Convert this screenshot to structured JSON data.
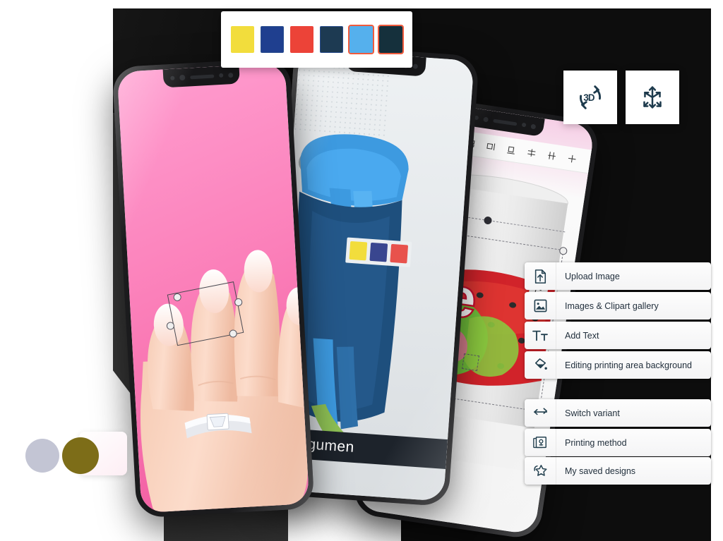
{
  "palette": {
    "name": "color-swatch-bar",
    "swatches": [
      {
        "name": "swatch-yellow",
        "color": "#f2dd3c",
        "selected": false,
        "border": false
      },
      {
        "name": "swatch-royal-blue",
        "color": "#1f3f8f",
        "selected": false,
        "border": true
      },
      {
        "name": "swatch-red",
        "color": "#ec4338",
        "selected": false,
        "border": false
      },
      {
        "name": "swatch-navy",
        "color": "#1d3a52",
        "selected": false,
        "border": true
      },
      {
        "name": "swatch-light-blue",
        "color": "#55b0ed",
        "selected": true,
        "border": false
      },
      {
        "name": "swatch-dark-teal",
        "color": "#15303c",
        "selected": true,
        "border": false
      }
    ]
  },
  "tools": {
    "rotate3d": {
      "label": "3D",
      "name": "rotate-3d-button"
    },
    "move": {
      "label": "",
      "name": "move-transform-button"
    }
  },
  "menu": {
    "group_one": [
      {
        "label": "Upload Image",
        "icon": "upload-image-icon"
      },
      {
        "label": "Images & Clipart gallery",
        "icon": "image-gallery-icon"
      },
      {
        "label": "Add Text",
        "icon": "add-text-icon"
      },
      {
        "label": "Editing printing area background",
        "icon": "paint-bucket-icon"
      }
    ],
    "group_two": [
      {
        "label": "Switch variant",
        "icon": "switch-variant-icon"
      },
      {
        "label": "Printing method",
        "icon": "printing-method-icon"
      },
      {
        "label": "My saved designs",
        "icon": "saved-designs-icon"
      }
    ]
  },
  "phones": {
    "ring": {
      "name": "phone-ring-preview",
      "background_color": "#fb7fb9",
      "subject": "hand-with-diamond-ring"
    },
    "jacket": {
      "name": "phone-jacket-preview",
      "brand_label": "Augumen",
      "mini_palette": [
        "#f2dd3c",
        "#39468f",
        "#e8524c"
      ],
      "subject": "blue-hoodie-jacket"
    },
    "ice": {
      "name": "phone-ice-preview",
      "design_text": "ice",
      "text_fill": "#ffffff",
      "text_outline": "#c8102e",
      "subject": "strawberry-ice-cream-artwork"
    }
  },
  "decor": {
    "dot_gray": "#c3c5d4",
    "dot_olive": "#7d6d18"
  }
}
